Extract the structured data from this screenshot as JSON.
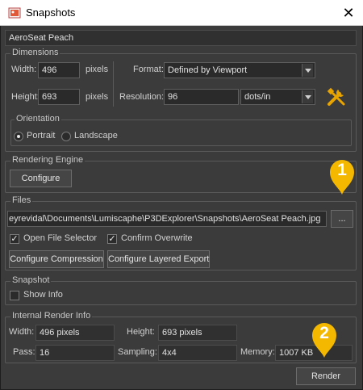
{
  "window": {
    "title": "Snapshots",
    "close_symbol": "✕"
  },
  "name_field": {
    "value": "AeroSeat Peach"
  },
  "dimensions": {
    "group_label": "Dimensions",
    "width_label": "Width:",
    "width_value": "496",
    "width_unit": "pixels",
    "height_label": "Height:",
    "height_value": "693",
    "height_unit": "pixels",
    "format_label": "Format:",
    "format_value": "Defined by Viewport",
    "resolution_label": "Resolution:",
    "resolution_value": "96",
    "resolution_unit": "dots/in",
    "orientation": {
      "group_label": "Orientation",
      "portrait_label": "Portrait",
      "landscape_label": "Landscape",
      "selected": "Portrait"
    }
  },
  "rendering_engine": {
    "group_label": "Rendering Engine",
    "configure_label": "Configure"
  },
  "files": {
    "group_label": "Files",
    "path_value": "eyrevidal\\Documents\\Lumiscaphe\\P3DExplorer\\Snapshots\\AeroSeat Peach.jpg",
    "browse_label": "...",
    "open_file_selector_label": "Open File Selector",
    "open_file_selector_checked": true,
    "confirm_overwrite_label": "Confirm Overwrite",
    "confirm_overwrite_checked": true,
    "configure_compression_label": "Configure Compression",
    "configure_layered_export_label": "Configure Layered Export"
  },
  "snapshot": {
    "group_label": "Snapshot",
    "show_info_label": "Show Info",
    "show_info_checked": false
  },
  "internal_render_info": {
    "group_label": "Internal Render Info",
    "width_label": "Width:",
    "width_value": "496 pixels",
    "height_label": "Height:",
    "height_value": "693 pixels",
    "pass_label": "Pass:",
    "pass_value": "16",
    "sampling_label": "Sampling:",
    "sampling_value": "4x4",
    "memory_label": "Memory:",
    "memory_value": "1007 KB"
  },
  "render_button": {
    "label": "Render"
  },
  "callouts": [
    {
      "number": "1"
    },
    {
      "number": "2"
    }
  ],
  "colors": {
    "callout": "#f5b800",
    "tools_icon": "#e8a400",
    "background": "#3b3b3b"
  }
}
